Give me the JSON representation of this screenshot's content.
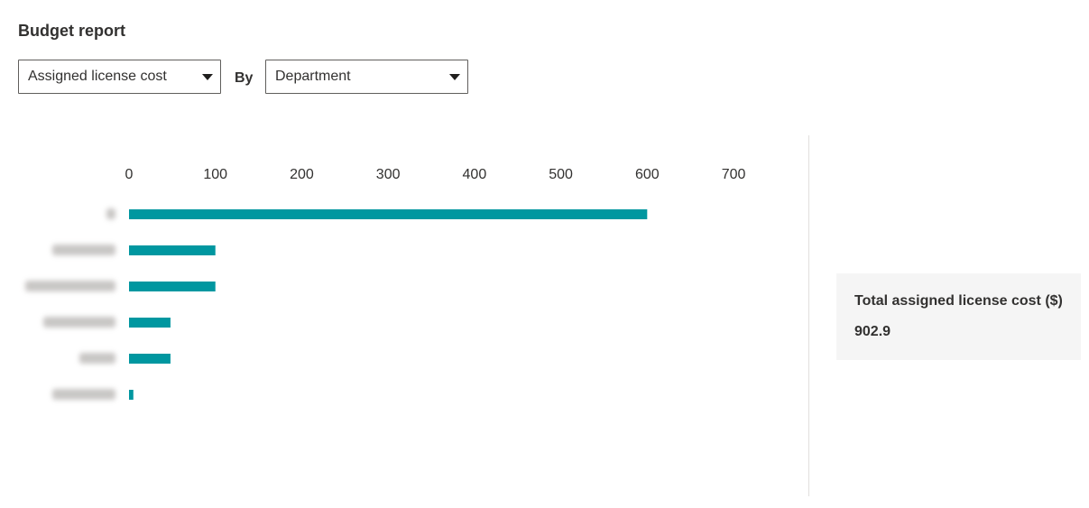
{
  "page": {
    "title": "Budget report"
  },
  "filters": {
    "metric_value": "Assigned license cost",
    "by_label": "By",
    "groupby_value": "Department"
  },
  "summary": {
    "label": "Total assigned license cost ($)",
    "value": "902.9"
  },
  "colors": {
    "bar": "#0097a0",
    "text": "#323130",
    "divider": "#e1dfdd",
    "card_bg": "#f5f5f5"
  },
  "icons": {
    "dropdown_caret": "caret-down-icon"
  },
  "chart_data": {
    "type": "bar",
    "orientation": "horizontal",
    "x_ticks": [
      0,
      100,
      200,
      300,
      400,
      500,
      600,
      700
    ],
    "xlim": [
      0,
      700
    ],
    "axis_position": "top",
    "grid": false,
    "categories_obscured": true,
    "values": [
      600,
      100,
      100,
      48,
      48,
      5
    ]
  }
}
